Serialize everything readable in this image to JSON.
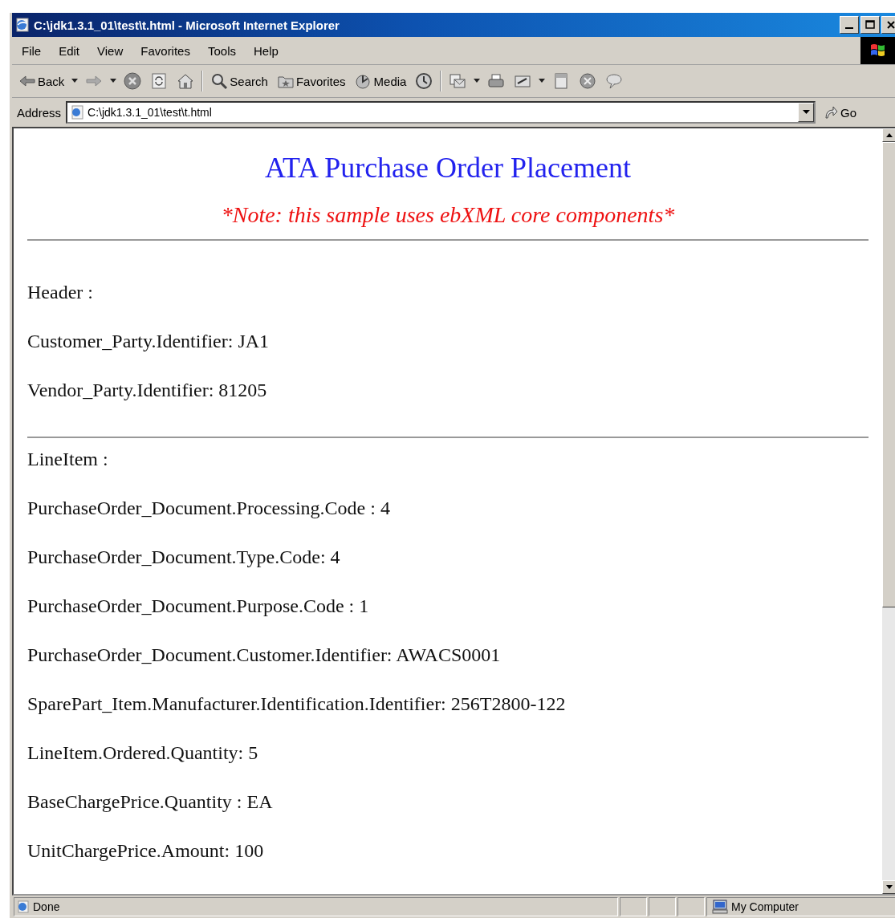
{
  "window": {
    "title": "C:\\jdk1.3.1_01\\test\\t.html - Microsoft Internet Explorer"
  },
  "menu": [
    "File",
    "Edit",
    "View",
    "Favorites",
    "Tools",
    "Help"
  ],
  "toolbar": [
    {
      "label": "Back",
      "caret": true
    },
    {
      "caret": true
    },
    {
      "caret": false
    },
    {
      "caret": false
    },
    {
      "caret": false
    },
    {
      "label": "Search",
      "caret": false
    },
    {
      "label": "Favorites",
      "caret": false
    },
    {
      "label": "Media",
      "caret": false
    },
    {
      "caret": false
    },
    {
      "caret": true
    },
    {
      "caret": false
    },
    {
      "caret": true
    },
    {
      "caret": false
    },
    {
      "caret": false
    },
    {
      "caret": false
    }
  ],
  "address": {
    "label": "Address",
    "value": "C:\\jdk1.3.1_01\\test\\t.html",
    "go": "Go"
  },
  "page": {
    "heading": "ATA Purchase Order Placement",
    "note": "*Note: this sample uses ebXML core components*",
    "sections": [
      {
        "lines": [
          "Header :",
          "Customer_Party.Identifier: JA1",
          "Vendor_Party.Identifier: 81205"
        ]
      },
      {
        "lines": [
          "LineItem :",
          "PurchaseOrder_Document.Processing.Code : 4",
          "PurchaseOrder_Document.Type.Code: 4",
          "PurchaseOrder_Document.Purpose.Code : 1",
          "PurchaseOrder_Document.Customer.Identifier: AWACS0001",
          "SparePart_Item.Manufacturer.Identification.Identifier: 256T2800-122",
          "LineItem.Ordered.Quantity: 5",
          "BaseChargePrice.Quantity : EA",
          "UnitChargePrice.Amount: 100"
        ]
      }
    ]
  },
  "status_bar": {
    "text": "Done",
    "zone": "My Computer"
  }
}
